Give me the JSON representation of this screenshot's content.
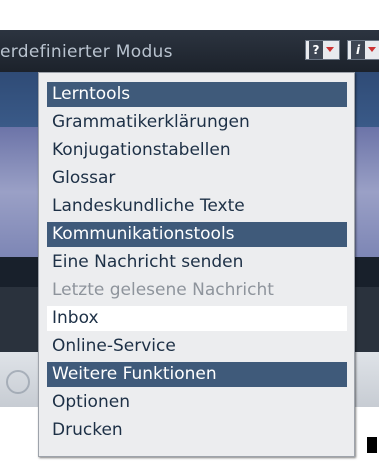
{
  "header": {
    "mode_label": "erdefinierter Modus",
    "help_button_glyph": "?",
    "info_button_glyph": "i"
  },
  "menu": {
    "items": [
      {
        "label": "Lerntools",
        "kind": "header"
      },
      {
        "label": "Grammatikerklärungen",
        "kind": "item"
      },
      {
        "label": "Konjugationstabellen",
        "kind": "item"
      },
      {
        "label": "Glossar",
        "kind": "item"
      },
      {
        "label": "Landeskundliche Texte",
        "kind": "item"
      },
      {
        "label": "Kommunikationstools",
        "kind": "header"
      },
      {
        "label": "Eine Nachricht senden",
        "kind": "item"
      },
      {
        "label": "Letzte gelesene Nachricht",
        "kind": "disabled"
      },
      {
        "label": "Inbox",
        "kind": "selected"
      },
      {
        "label": "Online-Service",
        "kind": "item"
      },
      {
        "label": "Weitere Funktionen",
        "kind": "header"
      },
      {
        "label": "Optionen",
        "kind": "item"
      },
      {
        "label": "Drucken",
        "kind": "item"
      }
    ]
  },
  "colors": {
    "section_header_bg": "#3f5a7a",
    "menu_text": "#1d3046",
    "disabled_text": "#8e949c",
    "menu_bg": "#ecedef"
  }
}
